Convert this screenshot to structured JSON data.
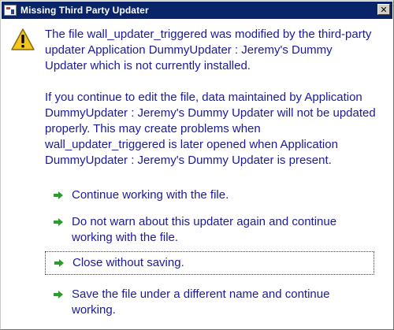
{
  "window": {
    "title": "Missing Third Party Updater",
    "close_label": "✕"
  },
  "message": {
    "paragraph1": "The file wall_updater_triggered was modified by the third-party updater Application DummyUpdater : Jeremy's Dummy Updater which is not currently installed.",
    "paragraph2": "If you continue to edit the file, data maintained by Application DummyUpdater : Jeremy's Dummy Updater will not be updated properly. This may create problems when wall_updater_triggered  is later opened when Application DummyUpdater : Jeremy's Dummy Updater is present."
  },
  "options": [
    {
      "label": "Continue working with the file."
    },
    {
      "label": "Do not warn about this updater again and continue working with the file."
    },
    {
      "label": "Close without saving."
    },
    {
      "label": "Save the file under a different name and continue working."
    }
  ],
  "colors": {
    "title_bar": "#0a246a",
    "text": "#1a1a99",
    "arrow": "#2e9b2e",
    "warning": "#f2c51f"
  },
  "icons": {
    "window": "app-icon",
    "warning": "warning-icon",
    "option": "green-arrow-icon"
  }
}
